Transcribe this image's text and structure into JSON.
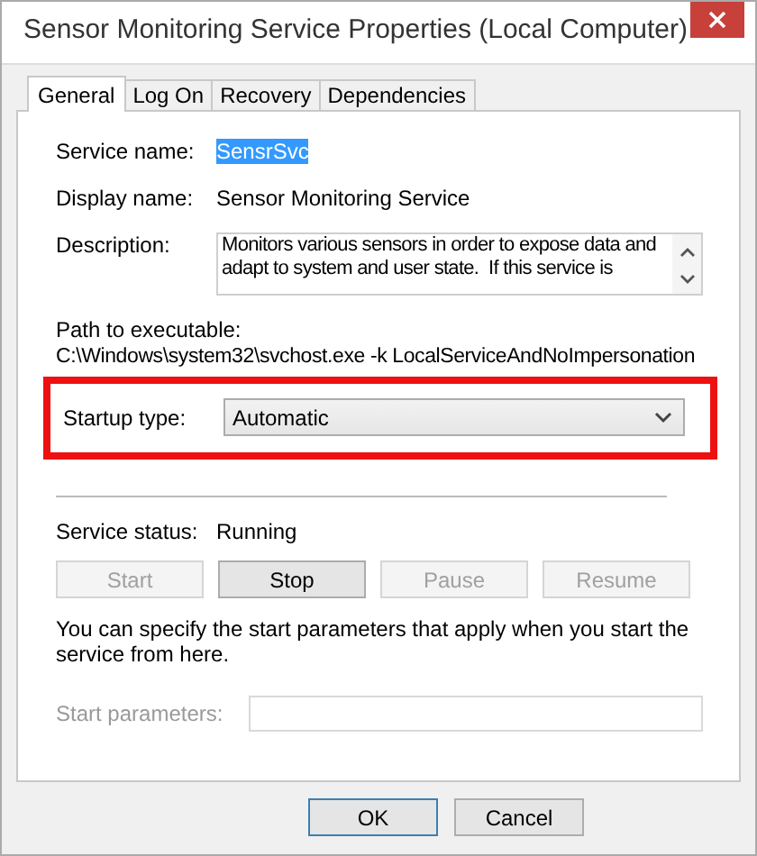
{
  "window": {
    "title": "Sensor Monitoring Service Properties (Local Computer)"
  },
  "tabs": [
    {
      "label": "General",
      "selected": true
    },
    {
      "label": "Log On",
      "selected": false
    },
    {
      "label": "Recovery",
      "selected": false
    },
    {
      "label": "Dependencies",
      "selected": false
    }
  ],
  "service_name": {
    "label": "Service name:",
    "value": "SensrSvc",
    "selected": true
  },
  "display_name": {
    "label": "Display name:",
    "value": "Sensor Monitoring Service"
  },
  "description": {
    "label": "Description:",
    "value": "Monitors various sensors in order to expose data and adapt to system and user state.  If this service is"
  },
  "path": {
    "label": "Path to executable:",
    "value": "C:\\Windows\\system32\\svchost.exe -k LocalServiceAndNoImpersonation"
  },
  "startup_type": {
    "label": "Startup type:",
    "value": "Automatic",
    "highlighted": true
  },
  "service_status": {
    "label": "Service status:",
    "value": "Running"
  },
  "control_buttons": [
    {
      "label": "Start",
      "disabled": true
    },
    {
      "label": "Stop",
      "disabled": false
    },
    {
      "label": "Pause",
      "disabled": true
    },
    {
      "label": "Resume",
      "disabled": true
    }
  ],
  "hint": "You can specify the start parameters that apply when you start the service from here.",
  "start_parameters": {
    "label": "Start parameters:",
    "disabled": true
  },
  "dialog_buttons": [
    {
      "label": "OK",
      "default": true
    },
    {
      "label": "Cancel",
      "default": false
    }
  ]
}
